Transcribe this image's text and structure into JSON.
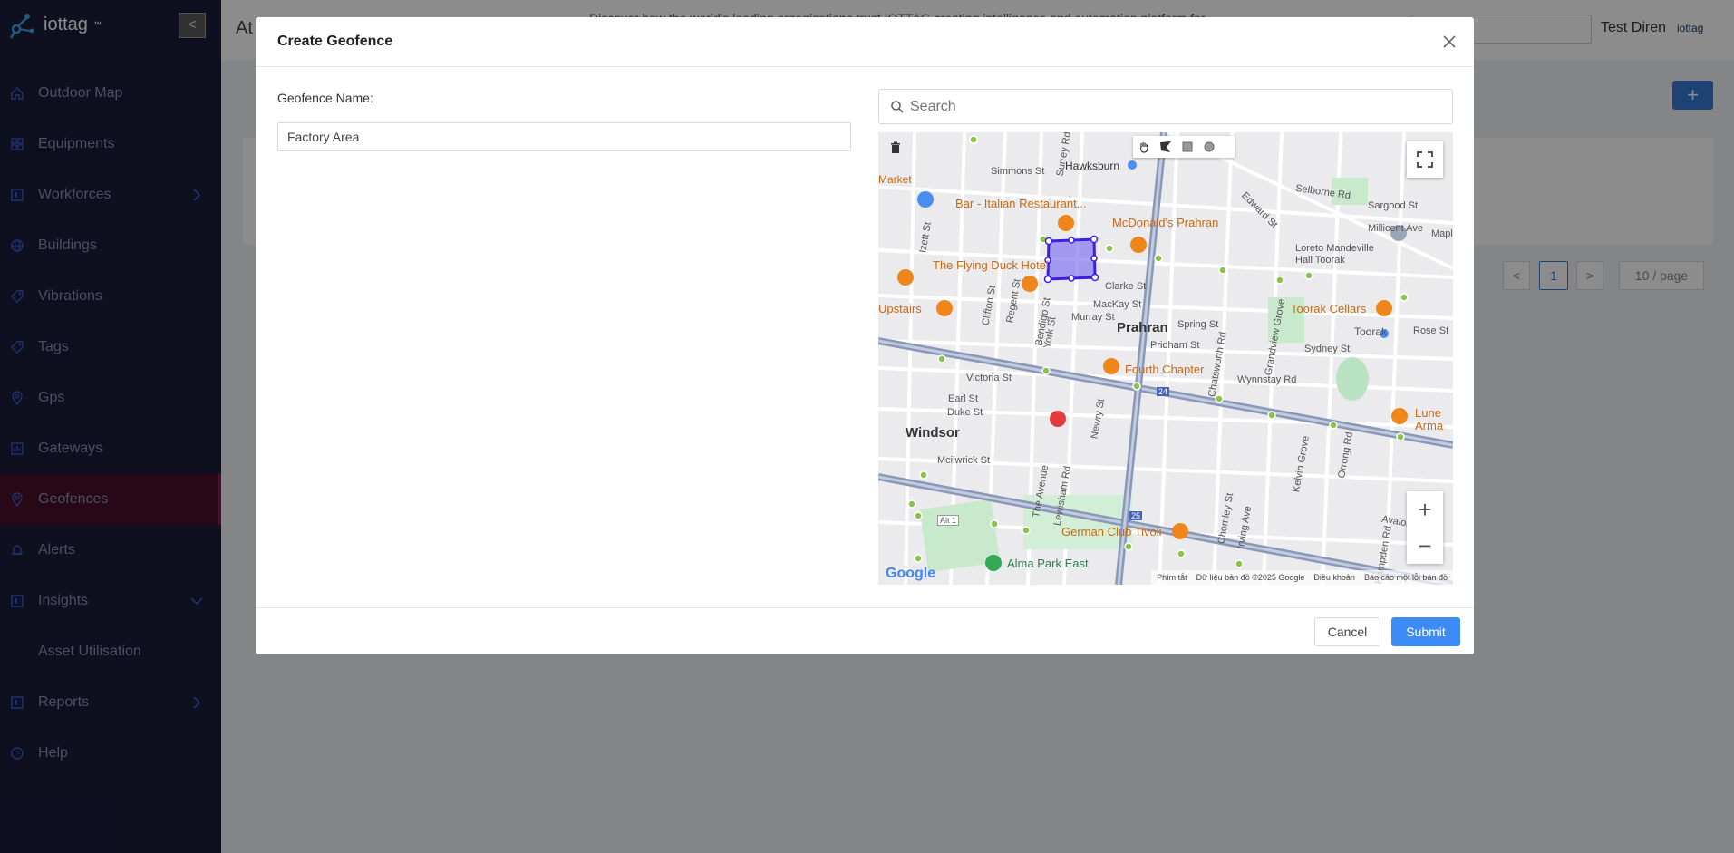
{
  "app": {
    "name": "iottag",
    "trademark": "™"
  },
  "sidebar": {
    "collapse_glyph": "<",
    "items": [
      {
        "label": "Outdoor Map",
        "icon": "home-icon"
      },
      {
        "label": "Equipments",
        "icon": "grid-icon"
      },
      {
        "label": "Workforces",
        "icon": "board-icon",
        "chevron": "right"
      },
      {
        "label": "Buildings",
        "icon": "globe-icon"
      },
      {
        "label": "Vibrations",
        "icon": "tag-icon"
      },
      {
        "label": "Tags",
        "icon": "tag-icon"
      },
      {
        "label": "Gps",
        "icon": "location-icon"
      },
      {
        "label": "Gateways",
        "icon": "chart-icon"
      },
      {
        "label": "Geofences",
        "icon": "location-icon",
        "active": true
      },
      {
        "label": "Alerts",
        "icon": "bell-icon"
      },
      {
        "label": "Insights",
        "icon": "board-icon",
        "chevron": "down"
      },
      {
        "label": "Asset Utilisation",
        "sub": true
      },
      {
        "label": "Reports",
        "icon": "board-icon",
        "chevron": "right"
      },
      {
        "label": "Help",
        "icon": "question-icon"
      }
    ]
  },
  "header": {
    "page_title": "At",
    "message": "Discover how the world's leading organisations trust IOTTAG creating intelligence and automation platform for",
    "user": "Test Diren",
    "brand": "iottag"
  },
  "background": {
    "add_label": "+",
    "pagination_current": "1",
    "page_size": "10 / page",
    "prev": "<",
    "next": ">"
  },
  "modal": {
    "title": "Create Geofence",
    "close_glyph": "×",
    "name_label": "Geofence Name:",
    "name_value": "Factory Area",
    "search_placeholder": "Search",
    "cancel_label": "Cancel",
    "submit_label": "Submit"
  },
  "map": {
    "suburbs": [
      "Prahran",
      "Windsor"
    ],
    "pois": [
      "Bar - Italian Restaurant...",
      "McDonald's Prahran",
      "The Flying Duck Hotel",
      "Fourth Chapter",
      "Toorak Cellars",
      "German Club Tivoli",
      "Upstairs",
      "Lune Arma"
    ],
    "parks": [
      "Alma Park East"
    ],
    "streets": [
      "Hawksburn",
      "Simmons St",
      "Selborne Rd",
      "Sargood St",
      "Millicent Ave",
      "Maple",
      "Loreto Mandeville Hall Toorak",
      "Toorak",
      "Rose St",
      "Clarke St",
      "MacKay St",
      "Murray St",
      "Spring St",
      "Pridham St",
      "Sydney St",
      "Wynnstay Rd",
      "Victoria St",
      "Earl St",
      "Duke St",
      "Mcilwrick St",
      "Clifton St",
      "Regent St",
      "Bendigo St",
      "York St",
      "Surrey Rd",
      "Edward St",
      "Grandview Grove",
      "Chatsworth Rd",
      "Newry St",
      "The Avenue",
      "Lewisham Rd",
      "Kelvin Grove",
      "Orrong Rd",
      "Irving Ave",
      "Chomley St",
      "Avalon Rd",
      "Hampden Rd",
      "Izett St",
      "Market",
      "Alt 1",
      "24",
      "25"
    ],
    "attribution": [
      "Phím tắt",
      "Dữ liệu bản đồ ©2025 Google",
      "Điều khoản",
      "Báo cáo một lỗi bản đồ"
    ],
    "google": "Google",
    "zoom_in": "+",
    "zoom_out": "−"
  }
}
